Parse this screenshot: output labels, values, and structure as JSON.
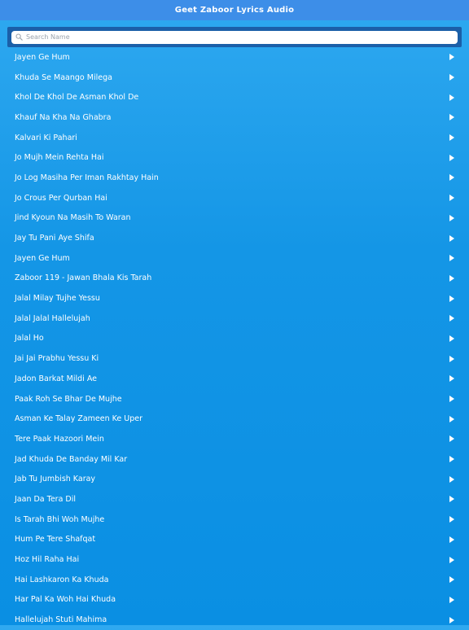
{
  "app": {
    "title": "Geet Zaboor Lyrics Audio"
  },
  "search": {
    "placeholder": "Search Name",
    "value": ""
  },
  "songs": [
    "Jayen Ge Hum",
    "Khuda Se Maango Milega",
    "Khol De Khol De Asman Khol De",
    "Khauf Na Kha Na Ghabra",
    "Kalvari Ki Pahari",
    "Jo Mujh Mein Rehta Hai",
    "Jo Log Masiha Per Iman Rakhtay Hain",
    "Jo Crous Per Qurban Hai",
    "Jind Kyoun Na Masih To Waran",
    "Jay Tu Pani Aye Shifa",
    "Jayen Ge Hum",
    "Zaboor 119 - Jawan Bhala Kis Tarah",
    "Jalal Milay Tujhe Yessu",
    "Jalal Jalal Hallelujah",
    "Jalal Ho",
    "Jai Jai Prabhu Yessu Ki",
    "Jadon Barkat Mildi Ae",
    "Paak Roh Se Bhar De Mujhe",
    "Asman Ke Talay Zameen Ke Uper",
    "Tere Paak Hazoori Mein",
    "Jad Khuda De Banday Mil Kar",
    "Jab Tu Jumbish Karay",
    "Jaan Da Tera Dil",
    "Is Tarah Bhi Woh Mujhe",
    "Hum Pe Tere Shafqat",
    "Hoz Hil Raha Hai",
    "Hai Lashkaron Ka Khuda",
    "Har Pal Ka Woh Hai Khuda",
    "Hallelujah Stuti Mahima"
  ]
}
